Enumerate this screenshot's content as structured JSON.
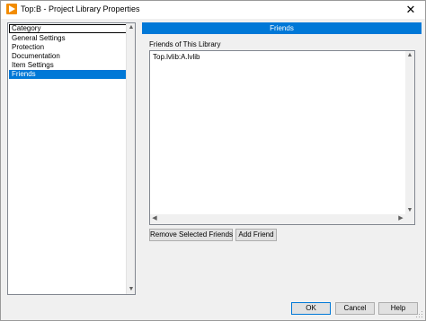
{
  "window": {
    "title": "Top:B - Project Library Properties",
    "close_glyph": "✕"
  },
  "category": {
    "header": "Category",
    "items": [
      {
        "label": "General Settings",
        "selected": false
      },
      {
        "label": "Protection",
        "selected": false
      },
      {
        "label": "Documentation",
        "selected": false
      },
      {
        "label": "Item Settings",
        "selected": false
      },
      {
        "label": "Friends",
        "selected": true
      }
    ]
  },
  "friends": {
    "section_title": "Friends",
    "list_label": "Friends of This Library",
    "items": [
      "Top.lvlib:A.lvlib"
    ],
    "remove_button": "Remove Selected Friends",
    "add_button": "Add Friend"
  },
  "footer": {
    "ok": "OK",
    "cancel": "Cancel",
    "help": "Help"
  },
  "colors": {
    "accent": "#0078d7",
    "app_icon": "#f28c00"
  },
  "icons": {
    "app": "labview-play-icon",
    "close": "close-icon",
    "scroll_up": "chevron-up-icon",
    "scroll_down": "chevron-down-icon",
    "scroll_left": "chevron-left-icon",
    "scroll_right": "chevron-right-icon",
    "resize": "resize-grip-icon"
  }
}
